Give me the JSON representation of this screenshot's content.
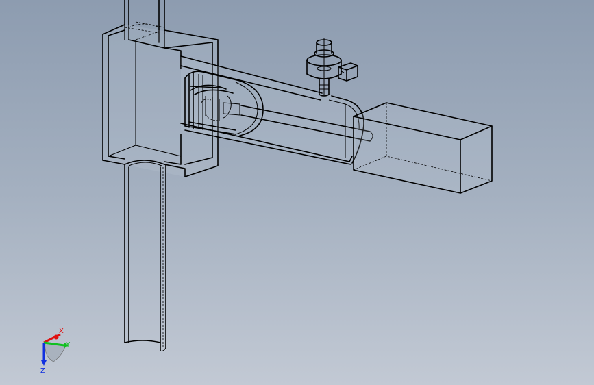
{
  "viewport": {
    "background_top": "#8d9cb0",
    "background_bottom": "#c2c9d4"
  },
  "triad": {
    "x_label": "X",
    "y_label": "Y",
    "z_label": "Z",
    "x_color": "#e01010",
    "y_color": "#10c020",
    "z_color": "#1030e0"
  }
}
